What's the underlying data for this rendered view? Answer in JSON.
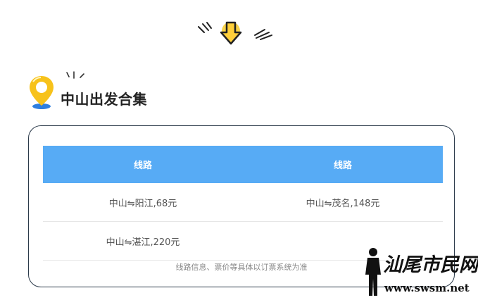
{
  "section": {
    "title": "中山出发合集"
  },
  "table": {
    "headers": [
      "线路",
      "线路"
    ],
    "rows": [
      [
        "中山⇋阳江,68元",
        "中山⇋茂名,148元"
      ],
      [
        "中山⇋湛江,220元",
        ""
      ]
    ]
  },
  "note": "线路信息、票价等具体以订票系统为准",
  "watermark": {
    "name": "汕尾市民网",
    "url": "www.swsm.net"
  },
  "colors": {
    "header_bg": "#57abf5",
    "pin_yellow": "#f7c21b",
    "pin_blue": "#2f7fe0",
    "card_border": "#2b3a4a"
  },
  "icons": [
    "down-arrow-icon",
    "location-pin-icon",
    "spark-lines-icon"
  ]
}
